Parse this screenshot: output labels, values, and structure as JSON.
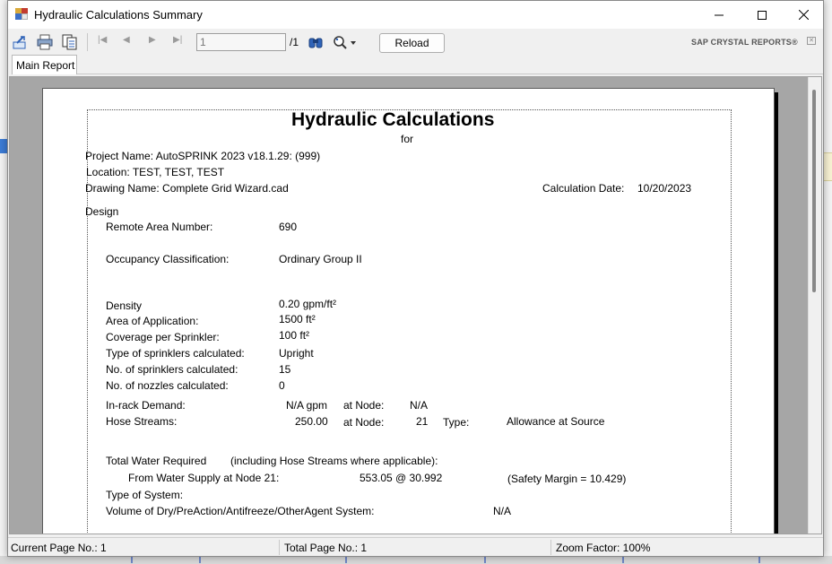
{
  "window": {
    "title": "Hydraulic Calculations Summary"
  },
  "toolbar": {
    "page_input_value": "1",
    "page_total": "/1",
    "reload_label": "Reload",
    "brand": "SAP CRYSTAL REPORTS®",
    "icons": [
      "export-icon",
      "print-icon",
      "toggle-group-tree-icon",
      "first-page-icon",
      "previous-page-icon",
      "next-page-icon",
      "last-page-icon",
      "find-icon",
      "zoom-icon"
    ]
  },
  "tabs": [
    {
      "label": "Main Report"
    }
  ],
  "report": {
    "title": "Hydraulic Calculations",
    "subtitle": "for",
    "project_name": "Project Name: AutoSPRINK 2023 v18.1.29: (999)",
    "location": "Location: TEST, TEST, TEST",
    "drawing_name": "Drawing Name: Complete Grid Wizard.cad",
    "calc_date_label": "Calculation Date:",
    "calc_date_value": "10/20/2023",
    "design_heading": "Design",
    "remote_area_label": "Remote Area Number:",
    "remote_area_value": "690",
    "occupancy_label": "Occupancy Classification:",
    "occupancy_value": "Ordinary Group II",
    "density_label": "Density",
    "density_value": "0.20 gpm/ft²",
    "area_label": "Area of Application:",
    "area_value": "1500 ft²",
    "coverage_label": "Coverage per Sprinkler:",
    "coverage_value": "100 ft²",
    "sprinkler_type_label": "Type of sprinklers calculated:",
    "sprinkler_type_value": "Upright",
    "num_sprinklers_label": "No. of sprinklers calculated:",
    "num_sprinklers_value": "15",
    "num_nozzles_label": "No. of nozzles calculated:",
    "num_nozzles_value": "0",
    "inrack_label": "In-rack Demand:",
    "inrack_value": "N/A gpm",
    "inrack_node_label": "at Node:",
    "inrack_node_value": "N/A",
    "hose_label": "Hose Streams:",
    "hose_value": "250.00",
    "hose_node_label": "at Node:",
    "hose_node_value": "21",
    "hose_type_label": "Type:",
    "hose_type_value": "Allowance at Source",
    "total_water_label": "Total Water Required",
    "total_water_note": "(including Hose Streams where applicable):",
    "from_supply_label": "From Water Supply at Node 21:",
    "from_supply_value": "553.05 @ 30.992",
    "safety_margin": "(Safety Margin = 10.429)",
    "system_type_label": "Type of System:",
    "volume_label": "Volume of Dry/PreAction/Antifreeze/OtherAgent System:",
    "volume_value": "N/A"
  },
  "statusbar": {
    "current_page": "Current Page No.: 1",
    "total_page": "Total Page No.: 1",
    "zoom": "Zoom Factor: 100%"
  }
}
